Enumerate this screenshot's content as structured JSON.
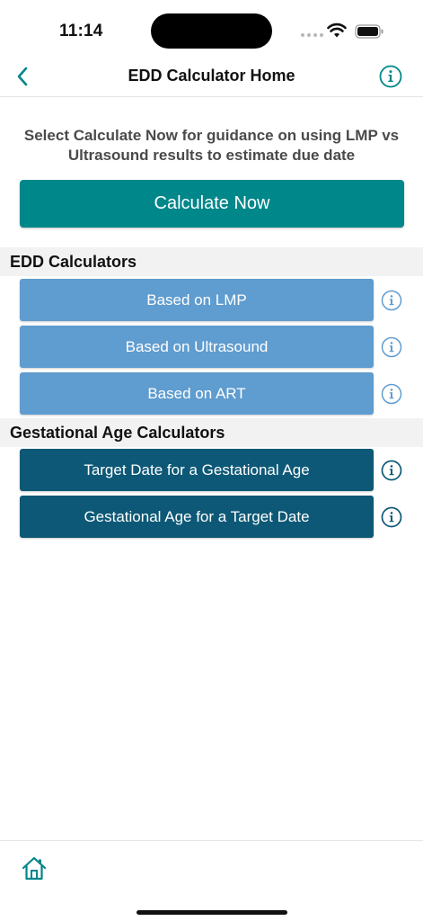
{
  "status_bar": {
    "time": "11:14"
  },
  "nav": {
    "title": "EDD Calculator Home",
    "back_icon": "chevron-left-icon",
    "info_icon": "info-circle-icon"
  },
  "intro": {
    "text": "Select Calculate Now for guidance on using LMP vs Ultrasound results to estimate due date",
    "button_label": "Calculate Now"
  },
  "sections": [
    {
      "title": "EDD Calculators",
      "items": [
        {
          "label": "Based on LMP"
        },
        {
          "label": "Based on Ultrasound"
        },
        {
          "label": "Based on ART"
        }
      ]
    },
    {
      "title": "Gestational Age Calculators",
      "items": [
        {
          "label": "Target Date for a Gestational Age"
        },
        {
          "label": "Gestational Age for a Target Date"
        }
      ]
    }
  ],
  "tab_bar": {
    "home_icon": "home-icon"
  },
  "colors": {
    "accent_teal": "#00878a",
    "light_blue_button": "#5f9ccf",
    "dark_blue_button": "#0d5876",
    "section_background": "#f2f2f2"
  }
}
